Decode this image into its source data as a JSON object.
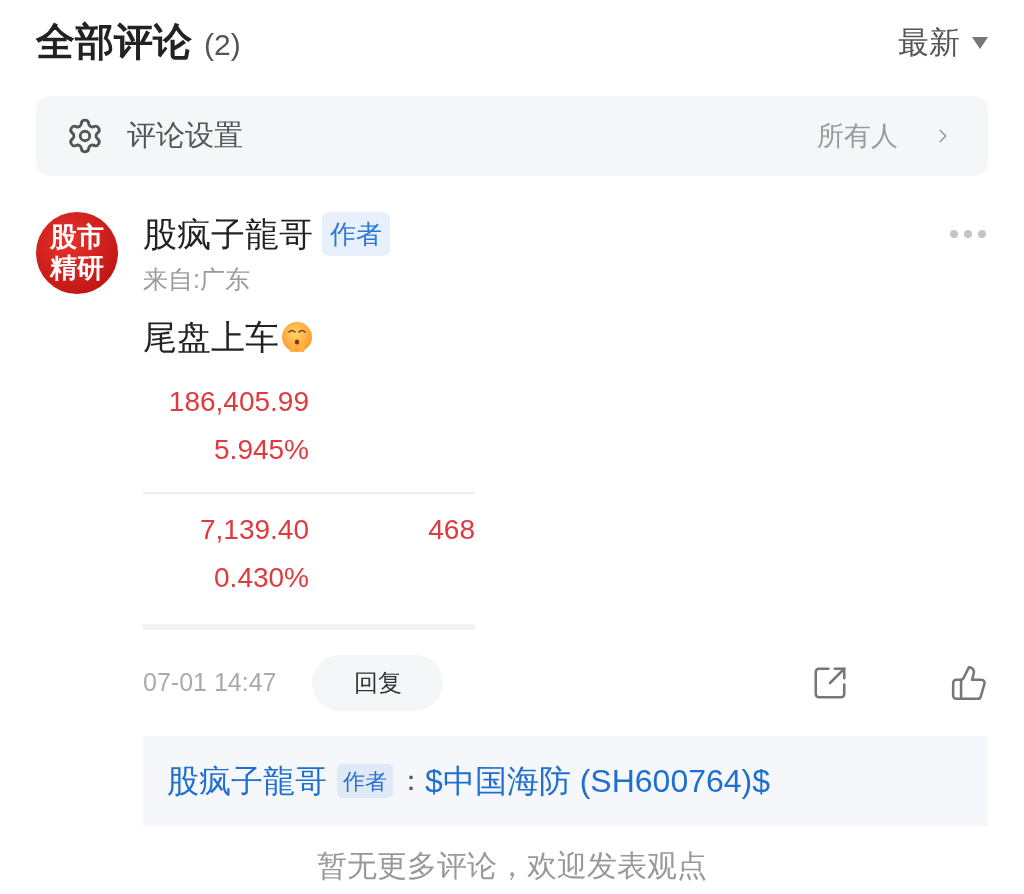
{
  "header": {
    "title": "全部评论",
    "count": "(2)",
    "sort": {
      "label": "最新"
    }
  },
  "settings_bar": {
    "label": "评论设置",
    "value": "所有人"
  },
  "comments": [
    {
      "avatar": {
        "lines": [
          "股市",
          "精研"
        ]
      },
      "author": "股疯子龍哥",
      "badge": "作者",
      "location": "来自:广东",
      "text": "尾盘上车",
      "stock_card": {
        "rows": [
          {
            "cells": [
              {
                "value": "186,405.99",
                "change": "5.945%"
              }
            ]
          },
          {
            "cells": [
              {
                "value": "7,139.40",
                "change": "0.430%"
              },
              {
                "value": "468"
              }
            ]
          }
        ]
      },
      "time": "07-01 14:47",
      "reply_button": "回复",
      "quote": {
        "author": "股疯子龍哥",
        "badge": "作者",
        "separator": "：",
        "text": "$中国海防 (SH600764)$"
      }
    }
  ],
  "footer_note": "暂无更多评论，欢迎发表观点"
}
